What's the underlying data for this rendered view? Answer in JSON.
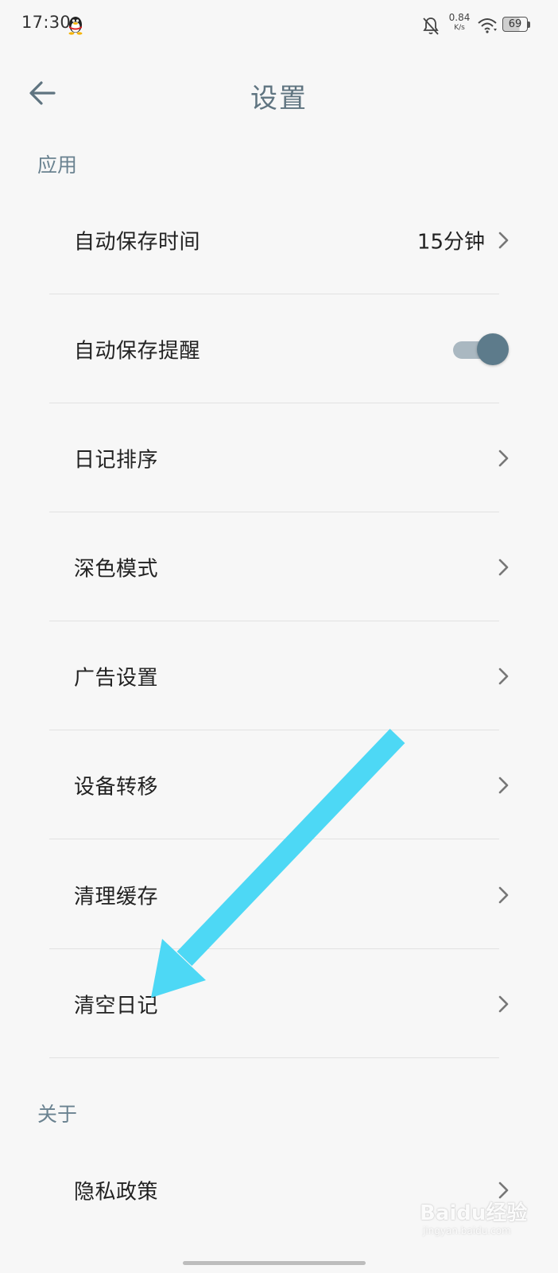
{
  "status_bar": {
    "time": "17:30",
    "net_speed_value": "0.84",
    "net_speed_unit": "K/s",
    "battery_level": "69",
    "icons": [
      "qq-penguin-icon",
      "bell-off-icon",
      "wifi-icon",
      "battery-icon"
    ]
  },
  "header": {
    "title": "设置",
    "back_icon": "back-arrow-icon"
  },
  "sections": {
    "app": {
      "title": "应用",
      "items": [
        {
          "label": "自动保存时间",
          "value": "15分钟",
          "control": "chevron"
        },
        {
          "label": "自动保存提醒",
          "control": "toggle",
          "toggle_on": true
        },
        {
          "label": "日记排序",
          "control": "chevron"
        },
        {
          "label": "深色模式",
          "control": "chevron"
        },
        {
          "label": "广告设置",
          "control": "chevron"
        },
        {
          "label": "设备转移",
          "control": "chevron"
        },
        {
          "label": "清理缓存",
          "control": "chevron"
        },
        {
          "label": "清空日记",
          "control": "chevron"
        }
      ]
    },
    "about": {
      "title": "关于",
      "items": [
        {
          "label": "隐私政策",
          "control": "chevron"
        }
      ]
    }
  },
  "colors": {
    "background": "#f7f7f7",
    "title": "#5f7480",
    "section_header": "#6a8290",
    "toggle_knob": "#5d7b8b",
    "toggle_track": "#aab8c1",
    "annotation_arrow": "#4dd8f5"
  },
  "watermark": {
    "text": "Baidu经验",
    "subtext": "jingyan.baidu.com"
  }
}
